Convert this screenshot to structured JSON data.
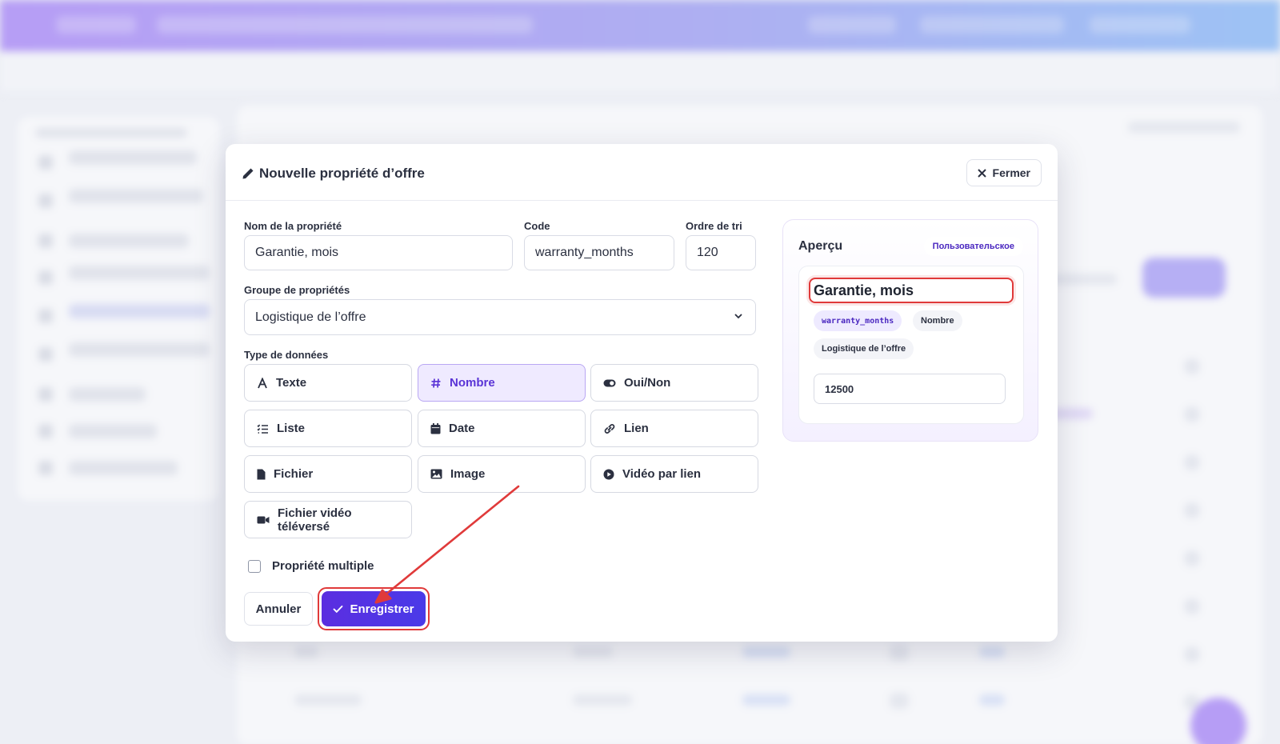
{
  "modal": {
    "title": "Nouvelle propriété d’offre",
    "close_label": "Fermer",
    "fields": {
      "name_label": "Nom de la propriété",
      "name_value": "Garantie, mois",
      "code_label": "Code",
      "code_value": "warranty_months",
      "sort_label": "Ordre de tri",
      "sort_value": "120",
      "group_label": "Groupe de propriétés",
      "group_value": "Logistique de l’offre",
      "type_label": "Type de données"
    },
    "data_types": [
      {
        "label": "Texte",
        "icon": "text-icon"
      },
      {
        "label": "Nombre",
        "icon": "hash-icon",
        "selected": true
      },
      {
        "label": "Oui/Non",
        "icon": "toggle-icon"
      },
      {
        "label": "Liste",
        "icon": "list-icon"
      },
      {
        "label": "Date",
        "icon": "calendar-icon"
      },
      {
        "label": "Lien",
        "icon": "link-icon"
      },
      {
        "label": "Fichier",
        "icon": "file-icon"
      },
      {
        "label": "Image",
        "icon": "image-icon"
      },
      {
        "label": "Vidéo par lien",
        "icon": "play-icon"
      },
      {
        "label": "Fichier vidéo téléversé",
        "icon": "video-camera-icon"
      }
    ],
    "multiple_label": "Propriété multiple",
    "multiple_checked": false,
    "cancel_label": "Annuler",
    "save_label": "Enregistrer"
  },
  "preview": {
    "title": "Aperçu",
    "badge": "Пользовательское",
    "name": "Garantie, mois",
    "code_chip": "warranty_months",
    "type_chip": "Nombre",
    "group_chip": "Logistique de l’offre",
    "example_value": "12500"
  },
  "colors": {
    "accent": "#5b2ee0",
    "highlight": "#e03a3a",
    "selected_bg": "#efeaff"
  }
}
